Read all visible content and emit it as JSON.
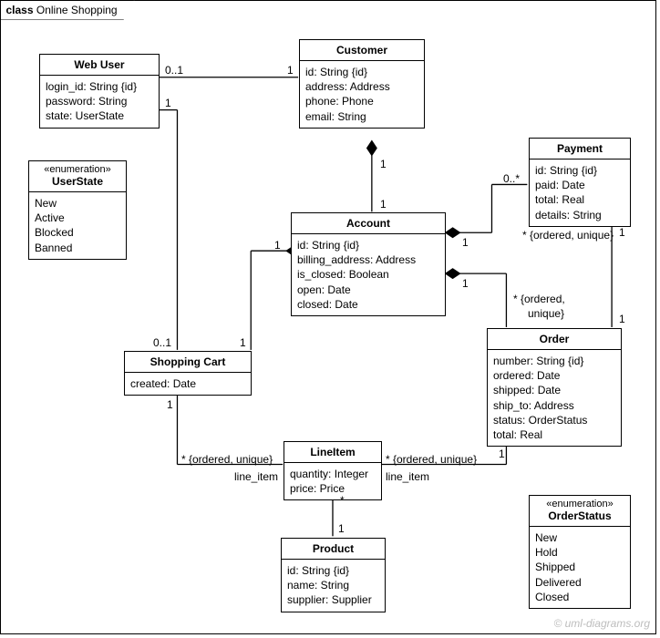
{
  "frame": {
    "kind": "class",
    "title": "Online Shopping"
  },
  "credit": "© uml-diagrams.org",
  "classes": {
    "webUser": {
      "name": "Web User",
      "attrs": [
        "login_id: String {id}",
        "password: String",
        "state: UserState"
      ]
    },
    "customer": {
      "name": "Customer",
      "attrs": [
        "id: String {id}",
        "address: Address",
        "phone: Phone",
        "email: String"
      ]
    },
    "payment": {
      "name": "Payment",
      "attrs": [
        "id: String {id}",
        "paid: Date",
        "total: Real",
        "details: String"
      ]
    },
    "userState": {
      "stereotype": "«enumeration»",
      "name": "UserState",
      "values": [
        "New",
        "Active",
        "Blocked",
        "Banned"
      ]
    },
    "account": {
      "name": "Account",
      "attrs": [
        "id: String {id}",
        "billing_address: Address",
        "is_closed: Boolean",
        "open: Date",
        "closed: Date"
      ]
    },
    "shoppingCart": {
      "name": "Shopping Cart",
      "attrs": [
        "created: Date"
      ]
    },
    "order": {
      "name": "Order",
      "attrs": [
        "number: String {id}",
        "ordered: Date",
        "shipped: Date",
        "ship_to: Address",
        "status: OrderStatus",
        "total: Real"
      ]
    },
    "lineItem": {
      "name": "LineItem",
      "attrs": [
        "quantity: Integer",
        "price: Price"
      ]
    },
    "product": {
      "name": "Product",
      "attrs": [
        "id: String {id}",
        "name: String",
        "supplier: Supplier"
      ]
    },
    "orderStatus": {
      "stereotype": "«enumeration»",
      "name": "OrderStatus",
      "values": [
        "New",
        "Hold",
        "Shipped",
        "Delivered",
        "Closed"
      ]
    }
  },
  "labels": {
    "wu_cust_0_1": "0..1",
    "wu_cust_1": "1",
    "cust_acct_top1": "1",
    "cust_acct_bot1": "1",
    "acct_pay_1": "1",
    "acct_pay_0s": "0..*",
    "pay_constraint": "* {ordered, unique}",
    "acct_order_1": "1",
    "order_constraint1": "* {ordered,",
    "order_constraint2": "unique}",
    "wu_cart_1": "1",
    "wu_cart_0_1": "0..1",
    "cart_acct_1L": "1",
    "cart_acct_1R": "1",
    "cart_li_star": "* {ordered, unique}",
    "cart_li_1": "1",
    "cart_li_role": "line_item",
    "order_li_star": "* {ordered, unique}",
    "order_li_1": "1",
    "order_li_role": "line_item",
    "li_prod_star": "*",
    "li_prod_1": "1",
    "order_pay_1a": "1",
    "order_pay_1b": "1"
  },
  "chart_data": {
    "type": "uml-class-diagram",
    "classes": [
      {
        "name": "Web User",
        "attributes": [
          "login_id: String {id}",
          "password: String",
          "state: UserState"
        ]
      },
      {
        "name": "Customer",
        "attributes": [
          "id: String {id}",
          "address: Address",
          "phone: Phone",
          "email: String"
        ]
      },
      {
        "name": "Account",
        "attributes": [
          "id: String {id}",
          "billing_address: Address",
          "is_closed: Boolean",
          "open: Date",
          "closed: Date"
        ]
      },
      {
        "name": "Payment",
        "attributes": [
          "id: String {id}",
          "paid: Date",
          "total: Real",
          "details: String"
        ]
      },
      {
        "name": "Shopping Cart",
        "attributes": [
          "created: Date"
        ]
      },
      {
        "name": "Order",
        "attributes": [
          "number: String {id}",
          "ordered: Date",
          "shipped: Date",
          "ship_to: Address",
          "status: OrderStatus",
          "total: Real"
        ]
      },
      {
        "name": "LineItem",
        "attributes": [
          "quantity: Integer",
          "price: Price"
        ]
      },
      {
        "name": "Product",
        "attributes": [
          "id: String {id}",
          "name: String",
          "supplier: Supplier"
        ]
      }
    ],
    "enumerations": [
      {
        "name": "UserState",
        "literals": [
          "New",
          "Active",
          "Blocked",
          "Banned"
        ]
      },
      {
        "name": "OrderStatus",
        "literals": [
          "New",
          "Hold",
          "Shipped",
          "Delivered",
          "Closed"
        ]
      }
    ],
    "relationships": [
      {
        "from": "Web User",
        "to": "Customer",
        "type": "association",
        "from_mult": "0..1",
        "to_mult": "1"
      },
      {
        "from": "Customer",
        "to": "Account",
        "type": "composition",
        "whole": "Customer",
        "from_mult": "1",
        "to_mult": "1"
      },
      {
        "from": "Web User",
        "to": "Shopping Cart",
        "type": "association",
        "from_mult": "1",
        "to_mult": "0..1"
      },
      {
        "from": "Account",
        "to": "Shopping Cart",
        "type": "composition",
        "whole": "Account",
        "from_mult": "1",
        "to_mult": "1"
      },
      {
        "from": "Account",
        "to": "Payment",
        "type": "composition",
        "whole": "Account",
        "from_mult": "1",
        "to_mult": "0..*"
      },
      {
        "from": "Account",
        "to": "Order",
        "type": "composition",
        "whole": "Account",
        "from_mult": "1",
        "to_mult": "*",
        "constraint": "{ordered, unique}"
      },
      {
        "from": "Order",
        "to": "Payment",
        "type": "association",
        "from_mult": "1",
        "to_mult": "*",
        "constraint": "{ordered, unique}"
      },
      {
        "from": "Shopping Cart",
        "to": "LineItem",
        "type": "association",
        "from_mult": "1",
        "to_mult": "*",
        "to_role": "line_item",
        "constraint": "{ordered, unique}"
      },
      {
        "from": "Order",
        "to": "LineItem",
        "type": "association",
        "from_mult": "1",
        "to_mult": "*",
        "to_role": "line_item",
        "constraint": "{ordered, unique}"
      },
      {
        "from": "LineItem",
        "to": "Product",
        "type": "association",
        "from_mult": "*",
        "to_mult": "1"
      }
    ]
  }
}
